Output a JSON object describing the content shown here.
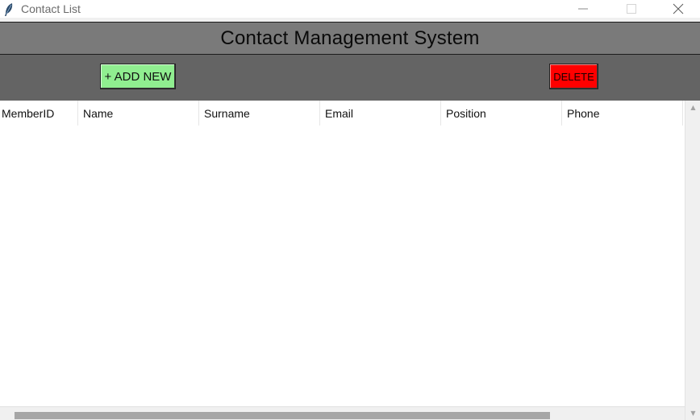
{
  "window": {
    "title": "Contact List",
    "icon": "feather-icon"
  },
  "header": {
    "heading": "Contact Management System"
  },
  "toolbar": {
    "add_label": "+ ADD NEW",
    "delete_label": "DELETE",
    "add_color": "#90ee90",
    "delete_color": "#ff0000"
  },
  "table": {
    "columns": [
      "MemberID",
      "Name",
      "Surname",
      "Email",
      "Position",
      "Phone"
    ],
    "rows": []
  },
  "colors": {
    "header_bg": "#7a7a7a",
    "toolbar_bg": "#646464"
  }
}
